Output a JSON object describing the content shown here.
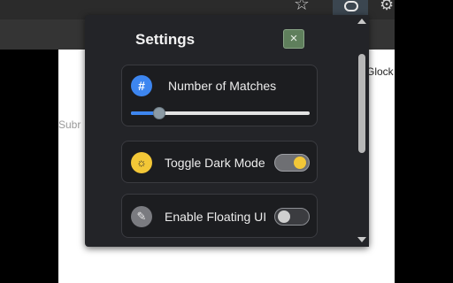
{
  "browser": {
    "page_text_right": "Glock",
    "page_text_left": "Subr"
  },
  "popup": {
    "title": "Settings",
    "close_symbol": "×",
    "settings": [
      {
        "label": "Number of Matches",
        "icon": "hash-icon",
        "icon_glyph": "#",
        "control": "slider",
        "value_fraction": 0.16
      },
      {
        "label": "Toggle Dark Mode",
        "icon": "sun-icon",
        "icon_glyph": "☼",
        "control": "toggle",
        "enabled": true
      },
      {
        "label": "Enable Floating UI",
        "icon": "wand-icon",
        "icon_glyph": "✎",
        "control": "toggle",
        "enabled": false
      }
    ]
  },
  "colors": {
    "accent": "#3d86f0",
    "toggle_on": "#f3c737",
    "close_button": "#5f7f5c",
    "popup_bg": "#232428"
  }
}
